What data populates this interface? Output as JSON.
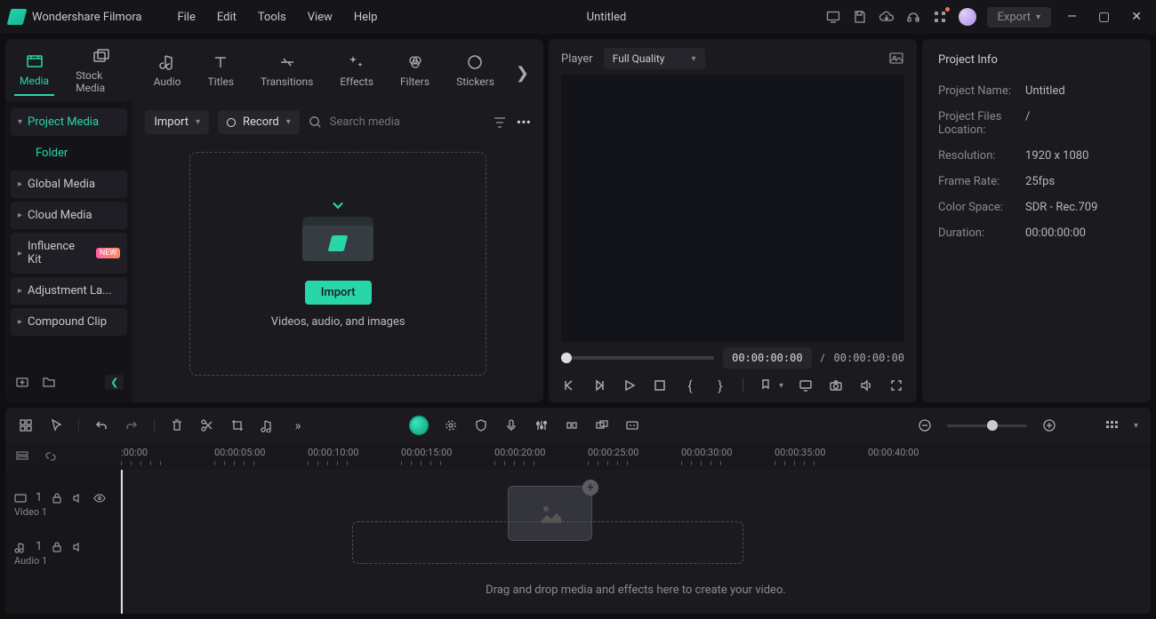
{
  "titlebar": {
    "app_name": "Wondershare Filmora",
    "document_title": "Untitled",
    "menu": {
      "file": "File",
      "edit": "Edit",
      "tools": "Tools",
      "view": "View",
      "help": "Help"
    },
    "export_label": "Export"
  },
  "tabs": {
    "media": "Media",
    "stock_media": "Stock Media",
    "audio": "Audio",
    "titles": "Titles",
    "transitions": "Transitions",
    "effects": "Effects",
    "filters": "Filters",
    "stickers": "Stickers"
  },
  "tree": {
    "project_media": "Project Media",
    "folder": "Folder",
    "global_media": "Global Media",
    "cloud_media": "Cloud Media",
    "influence_kit": "Influence Kit",
    "influence_badge": "NEW",
    "adjustment_layer": "Adjustment La...",
    "compound_clip": "Compound Clip"
  },
  "toolbar": {
    "import_label": "Import",
    "record_label": "Record",
    "search_placeholder": "Search media"
  },
  "dropzone": {
    "button": "Import",
    "hint": "Videos, audio, and images"
  },
  "player": {
    "label": "Player",
    "quality": "Full Quality",
    "current_time": "00:00:00:00",
    "sep": "/",
    "total_time": "00:00:00:00"
  },
  "project_info": {
    "title": "Project Info",
    "name_label": "Project Name:",
    "name_val": "Untitled",
    "loc_label": "Project Files Location:",
    "loc_val": "/",
    "res_label": "Resolution:",
    "res_val": "1920 x 1080",
    "fps_label": "Frame Rate:",
    "fps_val": "25fps",
    "cs_label": "Color Space:",
    "cs_val": "SDR - Rec.709",
    "dur_label": "Duration:",
    "dur_val": "00:00:00:00"
  },
  "ruler": [
    ":00:00",
    "00:00:05:00",
    "00:00:10:00",
    "00:00:15:00",
    "00:00:20:00",
    "00:00:25:00",
    "00:00:30:00",
    "00:00:35:00",
    "00:00:40:00"
  ],
  "tracks": {
    "video1_label": "Video 1",
    "video1_index": "1",
    "audio1_label": "Audio 1",
    "audio1_index": "1"
  },
  "timeline_hint": "Drag and drop media and effects here to create your video."
}
